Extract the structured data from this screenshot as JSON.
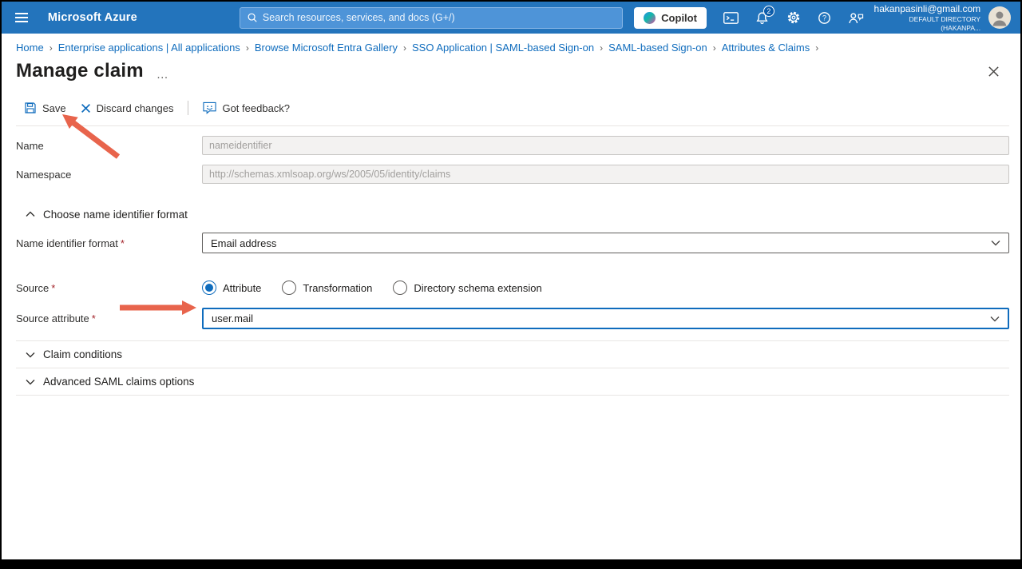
{
  "colors": {
    "header_bg": "#2374bc",
    "accent_blue": "#0f6cbd",
    "breadcrumb_link": "#0f6cbd",
    "annotation_arrow": "#e8644c",
    "required_asterisk": "#a4262c",
    "disabled_input_bg": "#f3f2f1"
  },
  "header": {
    "brand": "Microsoft Azure",
    "search_placeholder": "Search resources, services, and docs (G+/)",
    "copilot_label": "Copilot",
    "notification_count": "2",
    "account_email": "hakanpasinli@gmail.com",
    "account_directory": "DEFAULT DIRECTORY (HAKANPA..."
  },
  "breadcrumb": {
    "separator": "›",
    "items": [
      "Home",
      "Enterprise applications | All applications",
      "Browse Microsoft Entra Gallery",
      "SSO Application | SAML-based Sign-on",
      "SAML-based Sign-on",
      "Attributes & Claims"
    ]
  },
  "page": {
    "title": "Manage claim",
    "overflow_menu": "…"
  },
  "toolbar": {
    "save": "Save",
    "discard": "Discard changes",
    "feedback": "Got feedback?"
  },
  "form": {
    "name_label": "Name",
    "name_value": "nameidentifier",
    "namespace_label": "Namespace",
    "namespace_value": "http://schemas.xmlsoap.org/ws/2005/05/identity/claims",
    "identifier_section_title": "Choose name identifier format",
    "format_label": "Name identifier format",
    "format_value": "Email address",
    "source_label": "Source",
    "required_mark": "*",
    "source_options": [
      {
        "label": "Attribute",
        "selected": true
      },
      {
        "label": "Transformation",
        "selected": false
      },
      {
        "label": "Directory schema extension",
        "selected": false
      }
    ],
    "source_attribute_label": "Source attribute",
    "source_attribute_value": "user.mail",
    "claim_conditions_title": "Claim conditions",
    "advanced_section_title": "Advanced SAML claims options"
  }
}
